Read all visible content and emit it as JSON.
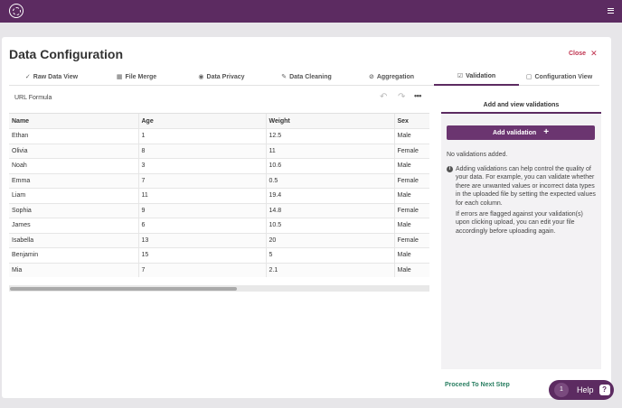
{
  "header": {
    "logo_icon": "logo-icon",
    "menu_icon": "hamburger-menu-icon"
  },
  "page": {
    "title": "Data Configuration",
    "close_label": "Close"
  },
  "tabs": [
    {
      "label": "Raw Data View",
      "icon": "check-circle-icon"
    },
    {
      "label": "File Merge",
      "icon": "table-icon"
    },
    {
      "label": "Data Privacy",
      "icon": "eye-icon"
    },
    {
      "label": "Data Cleaning",
      "icon": "edit-icon"
    },
    {
      "label": "Aggregation",
      "icon": "aggregation-icon"
    },
    {
      "label": "Validation",
      "icon": "checkbox-icon",
      "active": true
    },
    {
      "label": "Configuration View",
      "icon": "clipboard-icon"
    }
  ],
  "toolbar": {
    "url_formula_label": "URL Formula"
  },
  "table": {
    "columns": [
      "Name",
      "Age",
      "Weight",
      "Sex"
    ],
    "rows": [
      [
        "Ethan",
        "1",
        "12.5",
        "Male"
      ],
      [
        "Olivia",
        "8",
        "11",
        "Female"
      ],
      [
        "Noah",
        "3",
        "10.6",
        "Male"
      ],
      [
        "Emma",
        "7",
        "0.5",
        "Female"
      ],
      [
        "Liam",
        "11",
        "19.4",
        "Male"
      ],
      [
        "Sophia",
        "9",
        "14.8",
        "Female"
      ],
      [
        "James",
        "6",
        "10.5",
        "Male"
      ],
      [
        "Isabella",
        "13",
        "20",
        "Female"
      ],
      [
        "Benjamin",
        "15",
        "5",
        "Male"
      ],
      [
        "Mia",
        "7",
        "2.1",
        "Male"
      ]
    ]
  },
  "validation_panel": {
    "title": "Add and view validations",
    "add_button_label": "Add validation",
    "empty_text": "No validations added.",
    "info_1": "Adding validations can help control the quality of your data. For example, you can validate whether there are unwanted values or incorrect data types in the uploaded file by setting the expected values for each column.",
    "info_2": "If errors are flagged against your validation(s) upon clicking upload, you can edit your file accordingly before uploading again."
  },
  "footer": {
    "proceed_label": "Proceed To Next Step"
  },
  "help": {
    "count": "1",
    "label": "Help"
  },
  "colors": {
    "brand": "#5c2b61",
    "accent": "#c0334f",
    "proceed": "#2a7f62"
  }
}
